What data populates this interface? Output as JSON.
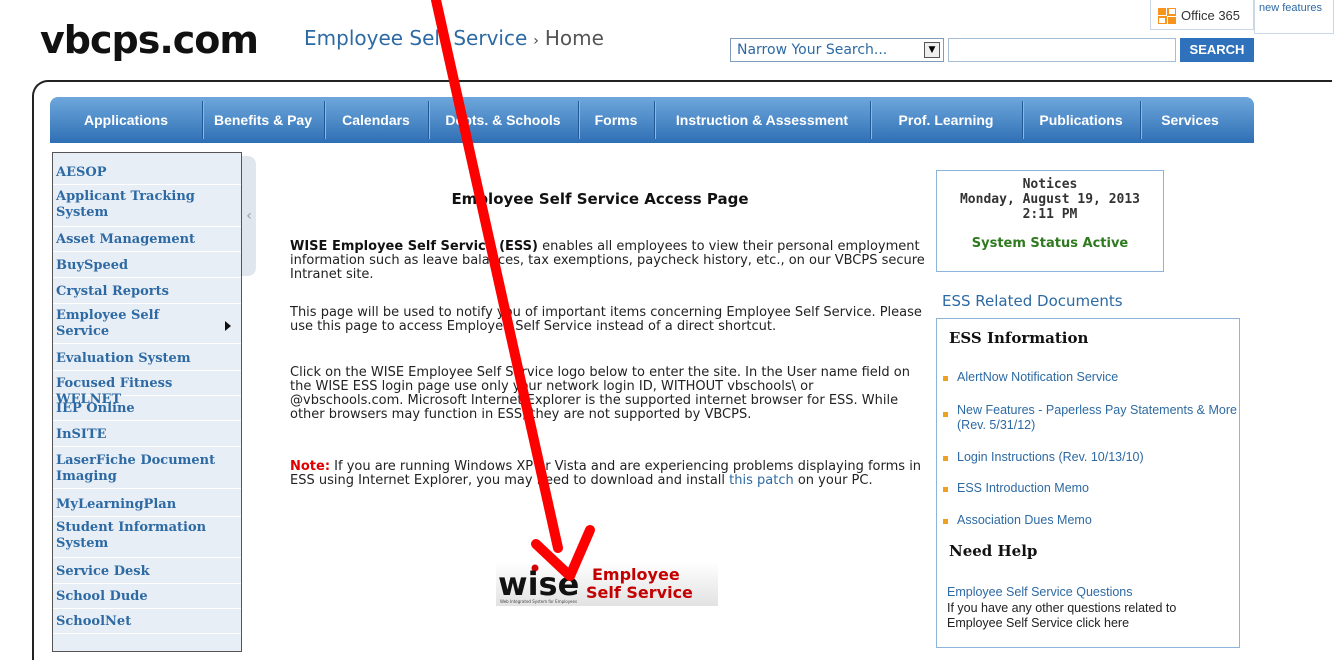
{
  "header": {
    "logo": "vbcps.com",
    "breadcrumb_section": "Employee Self Service",
    "breadcrumb_sep": "›",
    "breadcrumb_home": "Home",
    "search_select_value": "Narrow Your Search...",
    "search_input_value": "",
    "search_button": "SEARCH",
    "office365_label": "Office 365",
    "new_features_label": "new features"
  },
  "nav": {
    "items": [
      "Applications",
      "Benefits & Pay",
      "Calendars",
      "Depts. & Schools",
      "Forms",
      "Instruction & Assessment",
      "Prof. Learning",
      "Publications",
      "Services"
    ]
  },
  "sidebar": {
    "items": [
      "AESOP",
      "Applicant Tracking System",
      "Asset Management",
      "BuySpeed",
      "Crystal Reports",
      "Employee Self Service",
      "Evaluation System",
      "Focused Fitness WELNET",
      "IEP Online",
      "InSITE",
      "LaserFiche Document Imaging",
      "MyLearningPlan",
      "Student Information System",
      "Service Desk",
      "School Dude",
      "SchoolNet"
    ]
  },
  "main": {
    "title": "Employee Self Service Access Page",
    "p1_bold": "WISE Employee Self Service (ESS)",
    "p1_text": " enables all employees to view their personal employment information such as leave balances, tax exemptions, paycheck history, etc., on our VBCPS secure Intranet site.",
    "p2": "This page will be used to notify you of important items concerning Employee Self Service. Please use this page to access Employee Self Service instead of a direct shortcut.",
    "p3": "Click on the WISE Employee Self Service logo below to enter the site.  In the User name field on the WISE ESS login page use only your network login ID, WITHOUT vbschools\\ or @vbschools.com. Microsoft Internet Explorer is the supported internet browser for ESS. While other browsers may function in ESS, they are not supported by VBCPS.",
    "note_label": "Note:",
    "note_text": " If you are running Windows XP or Vista and are experiencing problems displaying forms in ESS using Internet Explorer, you may need to download and install ",
    "note_link": "this patch",
    "note_end": " on your PC.",
    "logo_wise": "wise",
    "logo_line1": "Employee",
    "logo_line2": "Self Service",
    "logo_tagline": "Web Integrated System for Employees"
  },
  "notices": {
    "title": "Notices",
    "date": "Monday, August 19, 2013",
    "time": "2:11 PM",
    "status": "System Status Active"
  },
  "ess_related": {
    "heading": "ESS Related Documents",
    "info_heading": "ESS Information",
    "links": [
      "AlertNow Notification Service",
      "New Features - Paperless Pay Statements & More (Rev. 5/31/12)",
      "Login Instructions (Rev. 10/13/10)",
      "ESS Introduction Memo",
      "Association Dues Memo"
    ],
    "help_heading": "Need Help",
    "help_link": "Employee Self Service Questions",
    "help_text": "If you have any other questions related to Employee Self Service click here"
  },
  "colors": {
    "link_blue": "#2d6aa3",
    "nav_blue": "#2f6fb4",
    "note_red": "#e00000",
    "status_green": "#2f7a1f",
    "annotation_arrow": "#ff0000"
  }
}
